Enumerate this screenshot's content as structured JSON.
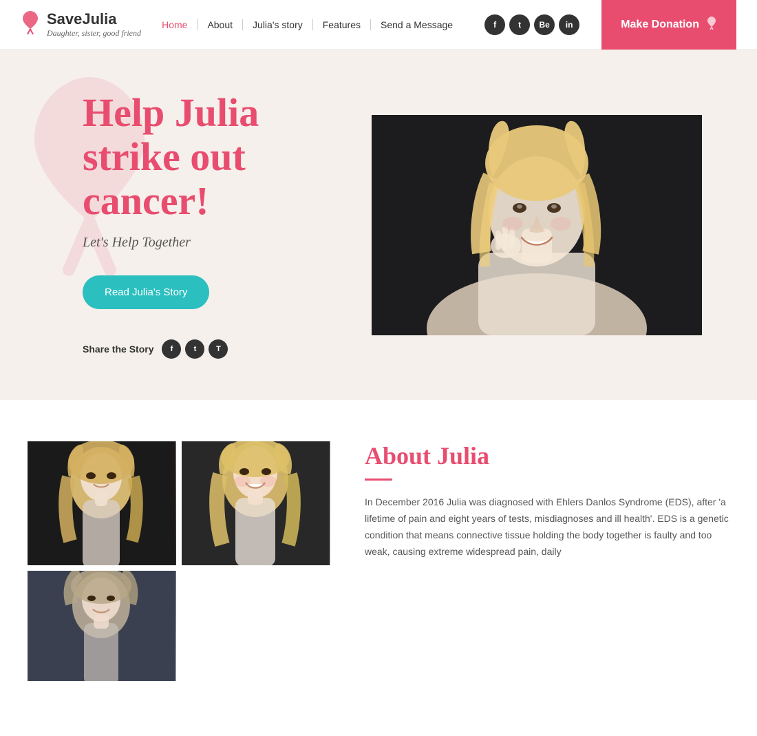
{
  "logo": {
    "title": "SaveJulia",
    "subtitle": "Daughter, sister, good friend",
    "ribbon_symbol": "♥"
  },
  "nav": {
    "items": [
      {
        "label": "Home",
        "active": true
      },
      {
        "label": "About",
        "active": false
      },
      {
        "label": "Julia's story",
        "active": false
      },
      {
        "label": "Features",
        "active": false
      },
      {
        "label": "Send a Message",
        "active": false
      }
    ]
  },
  "social": {
    "icons": [
      {
        "name": "facebook",
        "symbol": "f"
      },
      {
        "name": "twitter",
        "symbol": "t"
      },
      {
        "name": "behance",
        "symbol": "Be"
      },
      {
        "name": "instagram",
        "symbol": "in"
      }
    ]
  },
  "donate_button": {
    "label": "Make Donation"
  },
  "hero": {
    "title_line1": "Help Julia",
    "title_line2": "strike out",
    "title_line3": "cancer!",
    "subtitle": "Let's Help Together",
    "cta_button": "Read Julia's Story",
    "share_label": "Share the Story"
  },
  "share_icons": [
    {
      "name": "facebook",
      "symbol": "f"
    },
    {
      "name": "twitter",
      "symbol": "t"
    },
    {
      "name": "tumblr",
      "symbol": "T"
    }
  ],
  "about": {
    "title": "About Julia",
    "text": "In December 2016 Julia was diagnosed with Ehlers Danlos Syndrome (EDS), after 'a lifetime of pain and eight years of tests, misdiagnoses and ill health'. EDS is a genetic condition that means connective tissue holding the body together is faulty and too weak, causing extreme widespread pain, daily"
  },
  "colors": {
    "brand_pink": "#e84d6f",
    "teal": "#2bbfbf",
    "dark": "#333",
    "hero_bg": "#f5f0eb"
  }
}
